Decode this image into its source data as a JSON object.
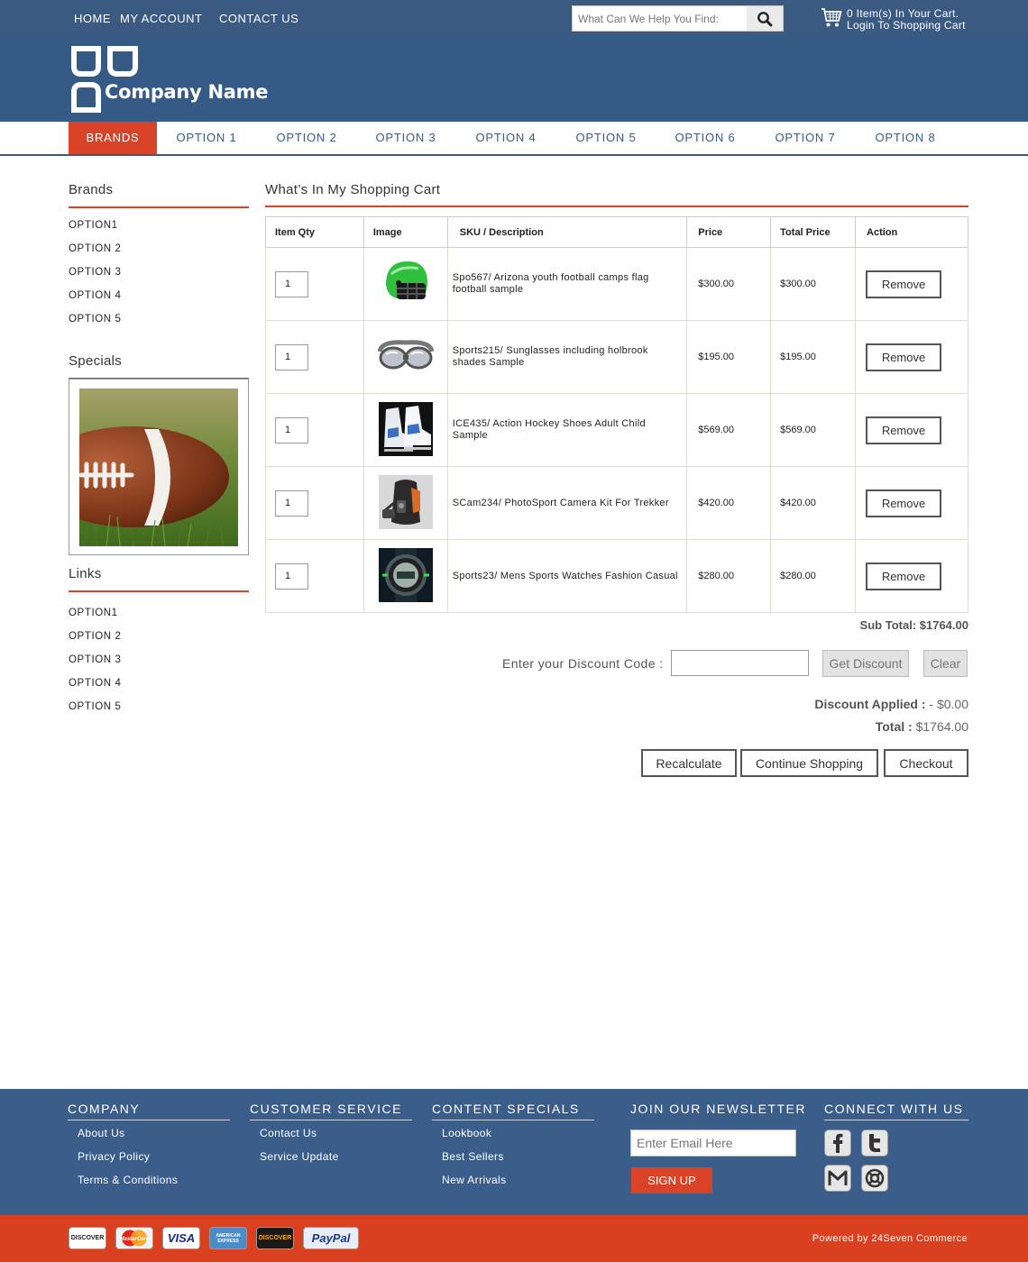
{
  "top_nav": {
    "home": "HOME",
    "account": "MY ACCOUNT",
    "contact": "CONTACT US"
  },
  "search": {
    "placeholder": "What Can We Help You Find:"
  },
  "cart_summary": {
    "items_text": "0  Item(s) In Your Cart.",
    "login_text": "Login To Shopping Cart"
  },
  "brand": {
    "company_name": "Company Name"
  },
  "main_nav": {
    "items": [
      "BRANDS",
      "OPTION 1",
      "OPTION 2",
      "OPTION 3",
      "OPTION 4",
      "OPTION 5",
      "OPTION 6",
      "OPTION 7",
      "OPTION 8"
    ],
    "active_index": 0
  },
  "sidebar": {
    "brands_title": "Brands",
    "brands": [
      "OPTION1",
      "OPTION 2",
      "OPTION 3",
      "OPTION 4",
      "OPTION 5"
    ],
    "specials_title": "Specials",
    "links_title": "Links",
    "links": [
      "OPTION1",
      "OPTION 2",
      "OPTION 3",
      "OPTION 4",
      "OPTION 5"
    ]
  },
  "cart": {
    "title": "What’s In My Shopping Cart",
    "headers": {
      "qty": "Item Qty",
      "image": "Image",
      "sku": "SKU / Description",
      "price": "Price",
      "total": "Total Price",
      "action": "Action"
    },
    "remove_label": "Remove",
    "items": [
      {
        "qty": "1",
        "image": "football-helmet",
        "description": "Spo567/ Arizona youth football camps flag football sample",
        "price": "$300.00",
        "total": "$300.00"
      },
      {
        "qty": "1",
        "image": "sunglasses",
        "description": "Sports215/ Sunglasses including holbrook shades Sample",
        "price": "$195.00",
        "total": "$195.00"
      },
      {
        "qty": "1",
        "image": "hockey-skates",
        "description": "ICE435/ Action Hockey Shoes Adult Child Sample",
        "price": "$569.00",
        "total": "$569.00"
      },
      {
        "qty": "1",
        "image": "camera-backpack",
        "description": "SCam234/ PhotoSport Camera Kit For Trekker",
        "price": "$420.00",
        "total": "$420.00"
      },
      {
        "qty": "1",
        "image": "sports-watch",
        "description": "Sports23/ Mens Sports Watches Fashion Casual",
        "price": "$280.00",
        "total": "$280.00"
      }
    ],
    "subtotal_label": "Sub Total:",
    "subtotal_value": "$1764.00",
    "discount_label": "Enter your Discount Code :",
    "discount_code": "",
    "get_discount": "Get Discount",
    "clear": "Clear",
    "discount_applied_label": "Discount Applied :",
    "discount_applied_value": "- $0.00",
    "total_label": "Total :",
    "total_value": "$1764.00",
    "recalculate": "Recalculate",
    "continue_shopping": "Continue Shopping",
    "checkout": "Checkout"
  },
  "footer": {
    "company_title": "COMPANY",
    "company_links": [
      "About Us",
      "Privacy Policy",
      "Terms & Conditions"
    ],
    "service_title": "CUSTOMER SERVICE",
    "service_links": [
      "Contact Us",
      "Service Update"
    ],
    "content_title": "CONTENT SPECIALS",
    "content_links": [
      "Lookbook",
      "Best Sellers",
      "New Arrivals"
    ],
    "newsletter_title": "JOIN OUR NEWSLETTER",
    "email_placeholder": "Enter Email Here",
    "signup": "SIGN UP",
    "connect_title": "CONNECT WITH US",
    "social_icons": [
      "facebook-icon",
      "twitter-icon",
      "gmail-icon",
      "support-icon"
    ],
    "cards": [
      "DISCOVER",
      "MasterCard",
      "VISA",
      "AMERICAN EXPRESS",
      "DISCOVER",
      "PayPal"
    ],
    "powered": "Powered by 24Seven Commerce"
  },
  "colors": {
    "brand_blue": "#365a86",
    "accent_orange": "#d94429"
  }
}
